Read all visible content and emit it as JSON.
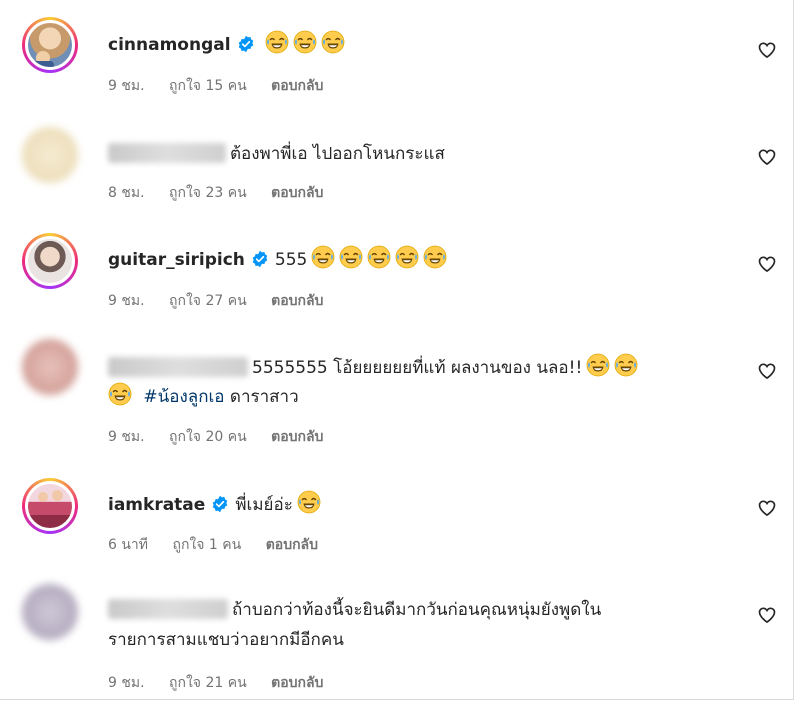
{
  "comments": [
    {
      "username": "cinnamongal",
      "verified": true,
      "blurred": false,
      "lines": [
        ""
      ],
      "emoji_count": 3,
      "time": "9 ชม.",
      "likes": "ถูกใจ 15 คน",
      "reply": "ตอบกลับ",
      "avatar_colors": [
        "#d9b38c",
        "#8a6b4a"
      ]
    },
    {
      "username": "",
      "verified": false,
      "blurred": true,
      "lines": [
        "ต้องพาพี่เอ ไปออกโหนกระแส"
      ],
      "emoji_count": 0,
      "time": "8 ชม.",
      "likes": "ถูกใจ 23 คน",
      "reply": "ตอบกลับ",
      "avatar_colors": [
        "#f1e4c3",
        "#e6d2a2"
      ]
    },
    {
      "username": "guitar_siripich",
      "verified": true,
      "blurred": false,
      "lines": [
        "555"
      ],
      "emoji_count": 5,
      "time": "9 ชม.",
      "likes": "ถูกใจ 27 คน",
      "reply": "ตอบกลับ",
      "avatar_colors": [
        "#e9e4e2",
        "#7c6a66"
      ]
    },
    {
      "username": "",
      "verified": false,
      "blurred": true,
      "lines": [
        "5555555 โอ้ยยยยยยที่แท้ ผลงานของ นลอ!!",
        "#น้องลูกเอ ดาราสาว"
      ],
      "emoji_count": 2,
      "time": "9 ชม.",
      "likes": "ถูกใจ 20 คน",
      "reply": "ตอบกลับ",
      "avatar_colors": [
        "#e3b9b0",
        "#c98e86"
      ]
    },
    {
      "username": "iamkratae",
      "verified": true,
      "blurred": false,
      "lines": [
        "พี่เมย์อ่ะ"
      ],
      "emoji_count": 1,
      "time": "6 นาที",
      "likes": "ถูกใจ 1 คน",
      "reply": "ตอบกลับ",
      "avatar_colors": [
        "#c64a6a",
        "#f3d7df"
      ]
    },
    {
      "username": "",
      "verified": false,
      "blurred": true,
      "lines": [
        "ถ้าบอกว่าท้องนี้จะยินดีมากวันก่อนคุณหนุ่มยังพูดใน",
        "รายการสามแชบว่าอยากมีอีกคน"
      ],
      "emoji_count": 0,
      "time": "9 ชม.",
      "likes": "ถูกใจ 21 คน",
      "reply": "ตอบกลับ",
      "avatar_colors": [
        "#c6c0cf",
        "#a69db3"
      ]
    }
  ],
  "icons": {
    "verified": "verified-badge-icon",
    "heart": "heart-outline-icon",
    "emoji": "face-with-tears-of-joy-icon"
  },
  "colors": {
    "verified_blue": "#0095f6",
    "hashtag": "#00376b",
    "meta_gray": "#737373"
  }
}
